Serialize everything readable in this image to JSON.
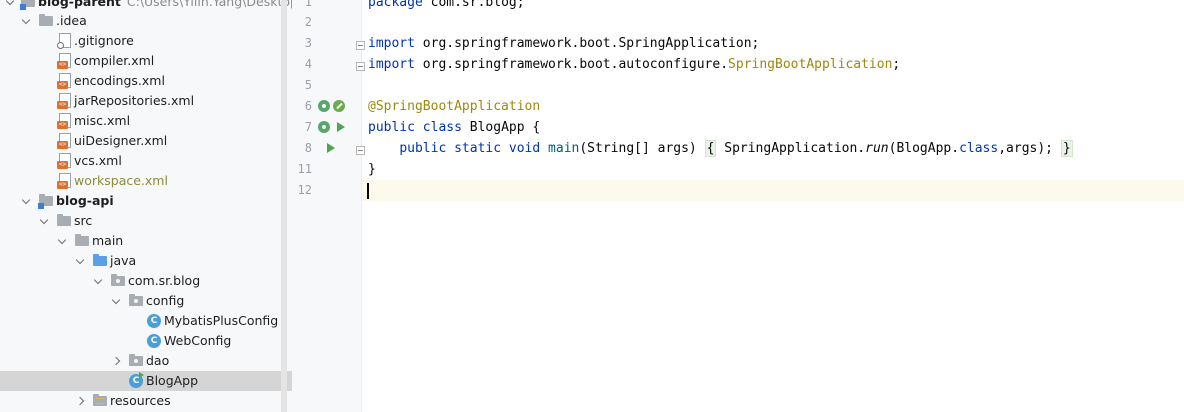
{
  "tree": {
    "root": {
      "label": "blog-parent",
      "path": "C:\\Users\\Yilin.Yang\\Desktop\\g"
    },
    "idea_folder": ".idea",
    "idea_files": [
      ".gitignore",
      "compiler.xml",
      "encodings.xml",
      "jarRepositories.xml",
      "misc.xml",
      "uiDesigner.xml",
      "vcs.xml",
      "workspace.xml"
    ],
    "module": "blog-api",
    "src": "src",
    "main": "main",
    "java": "java",
    "package": "com.sr.blog",
    "config": "config",
    "config_classes": [
      "MybatisPlusConfig",
      "WebConfig"
    ],
    "dao": "dao",
    "blogapp": "BlogApp",
    "resources": "resources",
    "icon_xml_text": "<>",
    "icon_class_text": "C"
  },
  "editor": {
    "line_numbers": [
      "1",
      "2",
      "3",
      "4",
      "5",
      "6",
      "7",
      "8",
      "11",
      "12"
    ],
    "lines": {
      "l1": {
        "kw": "package",
        "rest": " com.sr.blog;"
      },
      "l3": {
        "kw": "import",
        "rest": " org.springframework.boot.SpringApplication;"
      },
      "l4": {
        "kw": "import",
        "pre": " org.springframework.boot.autoconfigure.",
        "cls": "SpringBootApplication",
        "end": ";"
      },
      "l6": {
        "ann": "@SpringBootApplication"
      },
      "l7": {
        "kw1": "public",
        "kw2": "class",
        "rest": " BlogApp {"
      },
      "l8": {
        "indent": "    ",
        "kw1": "public",
        "kw2": "static",
        "kw3": "void",
        "fn": "main",
        "params": "(String[] args) ",
        "open": "{",
        "call_cls": " SpringApplication.",
        "call_fn": "run",
        "args_pre": "(BlogApp.",
        "args_kw": "class",
        "args_post": ",args); ",
        "close": "}"
      },
      "l11": "}"
    }
  }
}
